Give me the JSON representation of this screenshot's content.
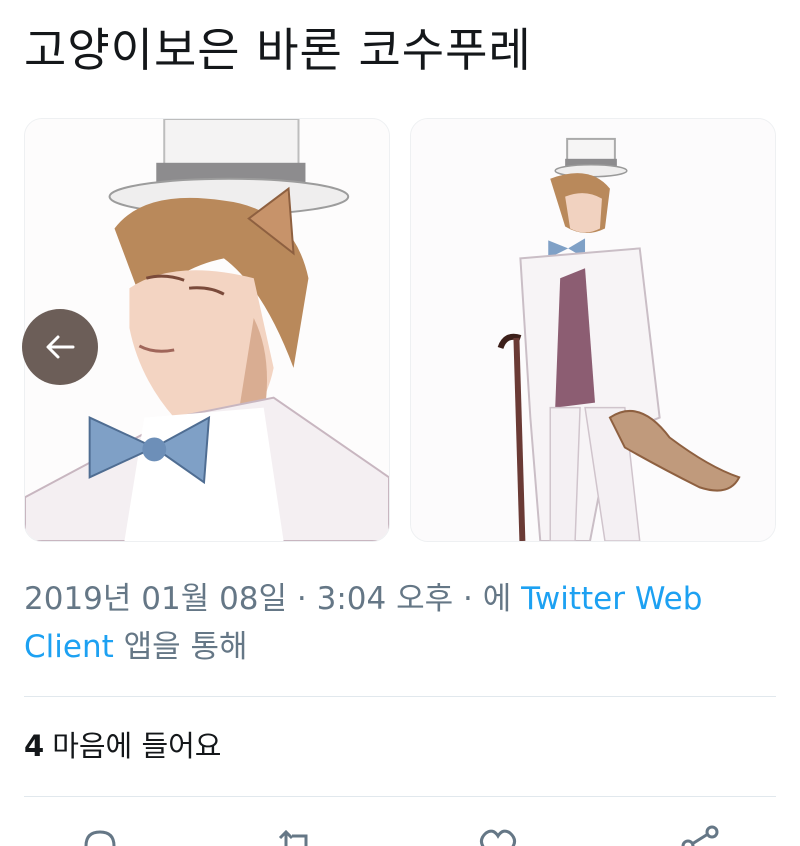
{
  "tweet": {
    "text": "고양이보은 바론 코수푸레"
  },
  "media": {
    "images": [
      {
        "alt": "top-hat-cat-character-closeup",
        "icon": "image-icon"
      },
      {
        "alt": "top-hat-cat-character-fullbody",
        "icon": "image-icon"
      }
    ],
    "prev_icon": "arrow-left-icon"
  },
  "meta": {
    "date": "2019년 01월 08일",
    "separator1": " · ",
    "time": "3:04 오후",
    "separator2": " · 에 ",
    "client_link_part1": "Twitter Web",
    "client_link_part2": "Client",
    "via_suffix": " 앱을 통해"
  },
  "likes": {
    "count": "4",
    "label": "마음에 들어요"
  },
  "actions": [
    {
      "name": "reply",
      "icon": "reply-icon"
    },
    {
      "name": "retweet",
      "icon": "retweet-icon"
    },
    {
      "name": "like",
      "icon": "heart-icon"
    },
    {
      "name": "share",
      "icon": "share-icon"
    }
  ],
  "colors": {
    "link": "#1da1f2",
    "meta_gray": "#657786",
    "text": "#14171a",
    "divider": "#e1e8ed",
    "overlay_button": "#5f504a"
  }
}
